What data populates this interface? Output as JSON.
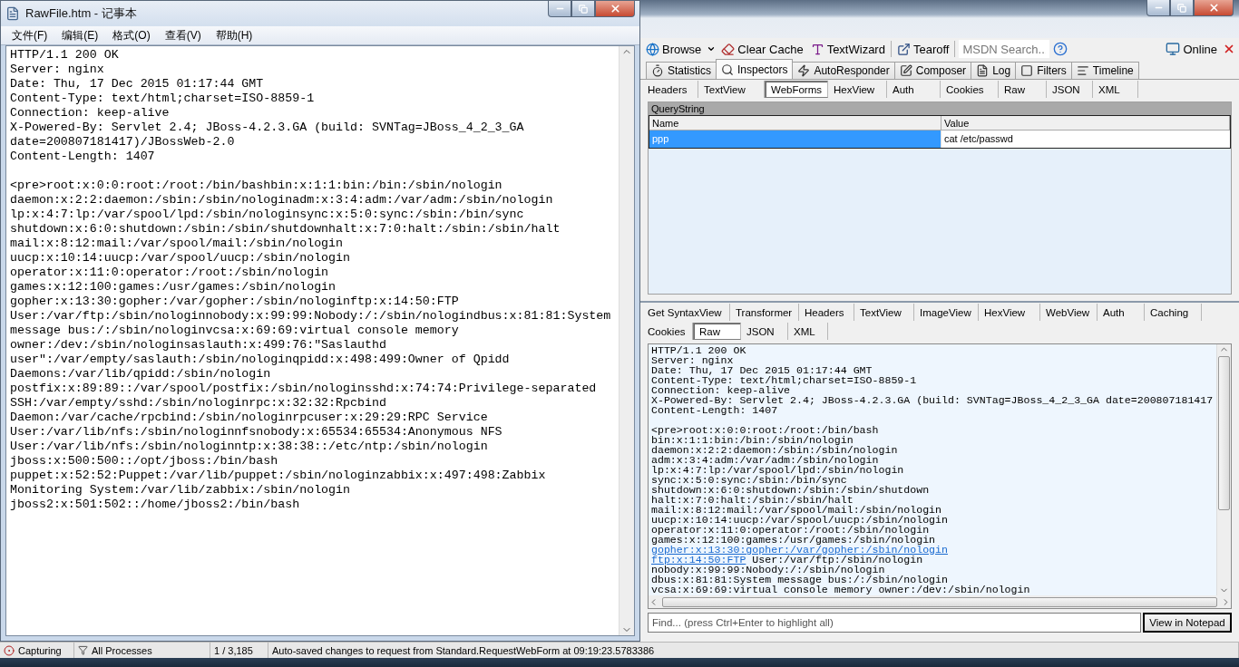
{
  "notepad": {
    "title": "RawFile.htm - 记事本",
    "menu": [
      "文件(F)",
      "编辑(E)",
      "格式(O)",
      "查看(V)",
      "帮助(H)"
    ],
    "headers": [
      "HTTP/1.1 200 OK",
      "Server: nginx",
      "Date: Thu, 17 Dec 2015 01:17:44 GMT",
      "Content-Type: text/html;charset=ISO-8859-1",
      "Connection: keep-alive",
      "X-Powered-By: Servlet 2.4; JBoss-4.2.3.GA (build: SVNTag=JBoss_4_2_3_GA",
      "date=200807181417)/JBossWeb-2.0",
      "Content-Length: 1407"
    ],
    "body": [
      "<pre>root:x:0:0:root:/root:/bin/bashbin:x:1:1:bin:/bin:/sbin/nologin",
      "daemon:x:2:2:daemon:/sbin:/sbin/nologinadm:x:3:4:adm:/var/adm:/sbin/nologin",
      "lp:x:4:7:lp:/var/spool/lpd:/sbin/nologinsync:x:5:0:sync:/sbin:/bin/sync",
      "shutdown:x:6:0:shutdown:/sbin:/sbin/shutdownhalt:x:7:0:halt:/sbin:/sbin/halt",
      "mail:x:8:12:mail:/var/spool/mail:/sbin/nologin",
      "uucp:x:10:14:uucp:/var/spool/uucp:/sbin/nologin",
      "operator:x:11:0:operator:/root:/sbin/nologin",
      "games:x:12:100:games:/usr/games:/sbin/nologin",
      "gopher:x:13:30:gopher:/var/gopher:/sbin/nologinftp:x:14:50:FTP",
      "User:/var/ftp:/sbin/nologinnobody:x:99:99:Nobody:/:/sbin/nologindbus:x:81:81:System",
      "message bus:/:/sbin/nologinvcsa:x:69:69:virtual console memory",
      "owner:/dev:/sbin/nologinsaslauth:x:499:76:\"Saslauthd",
      "user\":/var/empty/saslauth:/sbin/nologinqpidd:x:498:499:Owner of Qpidd",
      "Daemons:/var/lib/qpidd:/sbin/nologin",
      "postfix:x:89:89::/var/spool/postfix:/sbin/nologinsshd:x:74:74:Privilege-separated",
      "SSH:/var/empty/sshd:/sbin/nologinrpc:x:32:32:Rpcbind",
      "Daemon:/var/cache/rpcbind:/sbin/nologinrpcuser:x:29:29:RPC Service",
      "User:/var/lib/nfs:/sbin/nologinnfsnobody:x:65534:65534:Anonymous NFS",
      "User:/var/lib/nfs:/sbin/nologinntp:x:38:38::/etc/ntp:/sbin/nologin",
      "jboss:x:500:500::/opt/jboss:/bin/bash",
      "puppet:x:52:52:Puppet:/var/lib/puppet:/sbin/nologinzabbix:x:497:498:Zabbix",
      "Monitoring System:/var/lib/zabbix:/sbin/nologin",
      "jboss2:x:501:502::/home/jboss2:/bin/bash"
    ]
  },
  "fiddler": {
    "toolbar": {
      "browse": "Browse",
      "clear_cache": "Clear Cache",
      "text_wizard": "TextWizard",
      "tearoff": "Tearoff",
      "search": {
        "placeholder": "MSDN Search..."
      },
      "online": "Online"
    },
    "tabs": [
      {
        "label": "Statistics",
        "selected": false
      },
      {
        "label": "Inspectors",
        "selected": true
      },
      {
        "label": "AutoResponder",
        "selected": false
      },
      {
        "label": "Composer",
        "selected": false
      },
      {
        "label": "Log",
        "selected": false
      },
      {
        "label": "Filters",
        "selected": false
      },
      {
        "label": "Timeline",
        "selected": false
      }
    ],
    "request_tabs": [
      {
        "label": "Headers",
        "selected": false
      },
      {
        "label": "TextView",
        "selected": false
      },
      {
        "label": "WebForms",
        "selected": true
      },
      {
        "label": "HexView",
        "selected": false
      },
      {
        "label": "Auth",
        "selected": false
      },
      {
        "label": "Cookies",
        "selected": false
      },
      {
        "label": "Raw",
        "selected": false
      },
      {
        "label": "JSON",
        "selected": false
      },
      {
        "label": "XML",
        "selected": false
      }
    ],
    "querystring": {
      "title": "QueryString",
      "columns": [
        "Name",
        "Value"
      ],
      "rows": [
        {
          "name": "ppp",
          "value": "cat /etc/passwd",
          "selected": true
        }
      ]
    },
    "response_tab_rows": [
      [
        {
          "label": "Get SyntaxView",
          "selected": false
        },
        {
          "label": "Transformer",
          "selected": false
        },
        {
          "label": "Headers",
          "selected": false
        },
        {
          "label": "TextView",
          "selected": false
        },
        {
          "label": "ImageView",
          "selected": false
        },
        {
          "label": "HexView",
          "selected": false
        },
        {
          "label": "WebView",
          "selected": false
        },
        {
          "label": "Auth",
          "selected": false
        },
        {
          "label": "Caching",
          "selected": false
        }
      ],
      [
        {
          "label": "Cookies",
          "selected": false
        },
        {
          "label": "Raw",
          "selected": true
        },
        {
          "label": "JSON",
          "selected": false
        },
        {
          "label": "XML",
          "selected": false
        }
      ]
    ],
    "raw": {
      "headers": [
        "HTTP/1.1 200 OK",
        "Server: nginx",
        "Date: Thu, 17 Dec 2015 01:17:44 GMT",
        "Content-Type: text/html;charset=ISO-8859-1",
        "Connection: keep-alive",
        "X-Powered-By: Servlet 2.4; JBoss-4.2.3.GA (build: SVNTag=JBoss_4_2_3_GA date=200807181417",
        "Content-Length: 1407"
      ],
      "body": [
        {
          "text": "<pre>root:x:0:0:root:/root:/bin/bash"
        },
        {
          "text": "bin:x:1:1:bin:/bin:/sbin/nologin"
        },
        {
          "text": "daemon:x:2:2:daemon:/sbin:/sbin/nologin"
        },
        {
          "text": "adm:x:3:4:adm:/var/adm:/sbin/nologin"
        },
        {
          "text": "lp:x:4:7:lp:/var/spool/lpd:/sbin/nologin"
        },
        {
          "text": "sync:x:5:0:sync:/sbin:/bin/sync"
        },
        {
          "text": "shutdown:x:6:0:shutdown:/sbin:/sbin/shutdown"
        },
        {
          "text": "halt:x:7:0:halt:/sbin:/sbin/halt"
        },
        {
          "text": "mail:x:8:12:mail:/var/spool/mail:/sbin/nologin"
        },
        {
          "text": "uucp:x:10:14:uucp:/var/spool/uucp:/sbin/nologin"
        },
        {
          "text": "operator:x:11:0:operator:/root:/sbin/nologin"
        },
        {
          "text": "games:x:12:100:games:/usr/games:/sbin/nologin"
        },
        {
          "link": "gopher:x:13:30:gopher:/var/gopher:/sbin/nologin"
        },
        {
          "link": "ftp:x:14:50:FTP",
          "text": "User:/var/ftp:/sbin/nologin"
        },
        {
          "text": "nobody:x:99:99:Nobody:/:/sbin/nologin"
        },
        {
          "text": "dbus:x:81:81:System message bus:/:/sbin/nologin"
        },
        {
          "text": "vcsa:x:69:69:virtual console memory owner:/dev:/sbin/nologin"
        }
      ]
    },
    "find": {
      "placeholder": "Find... (press Ctrl+Enter to highlight all)"
    },
    "view_button": "View in Notepad"
  },
  "status_bar": {
    "capture": "Capturing",
    "process_filter": "All Processes",
    "count": "1 / 3,185",
    "message": "Auto-saved changes to request from Standard.RequestWebForm at 09:19:23.5783386"
  }
}
